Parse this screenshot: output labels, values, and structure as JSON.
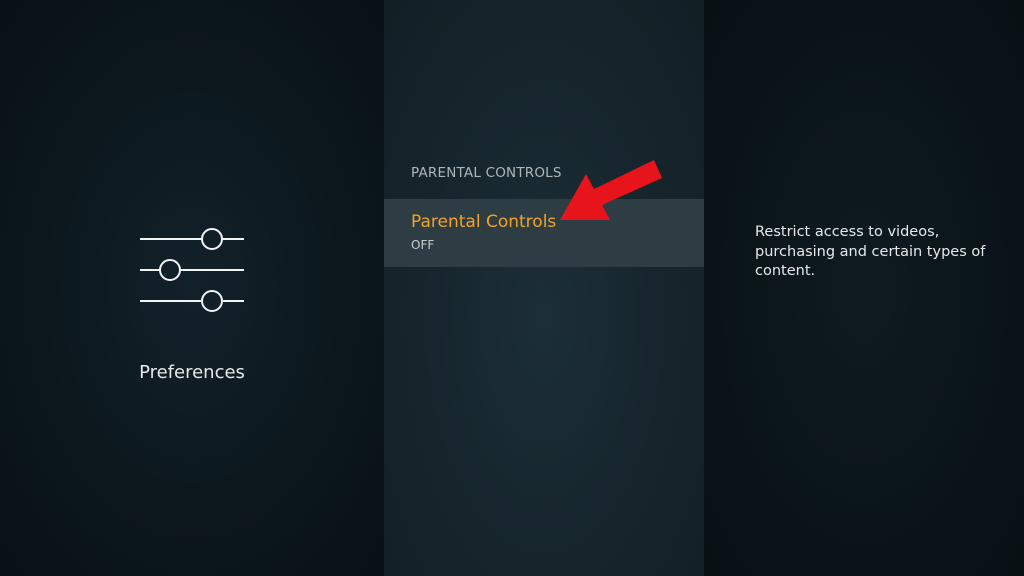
{
  "left": {
    "icon": "sliders-icon",
    "label": "Preferences"
  },
  "center": {
    "section_header": "PARENTAL CONTROLS",
    "items": [
      {
        "title": "Parental Controls",
        "status": "OFF"
      }
    ]
  },
  "right": {
    "description": "Restrict access to videos, purchasing and certain types of content."
  },
  "colors": {
    "accent": "#f2a325",
    "highlight_bg": "#2e3d44",
    "annotation_arrow": "#e8141b"
  }
}
